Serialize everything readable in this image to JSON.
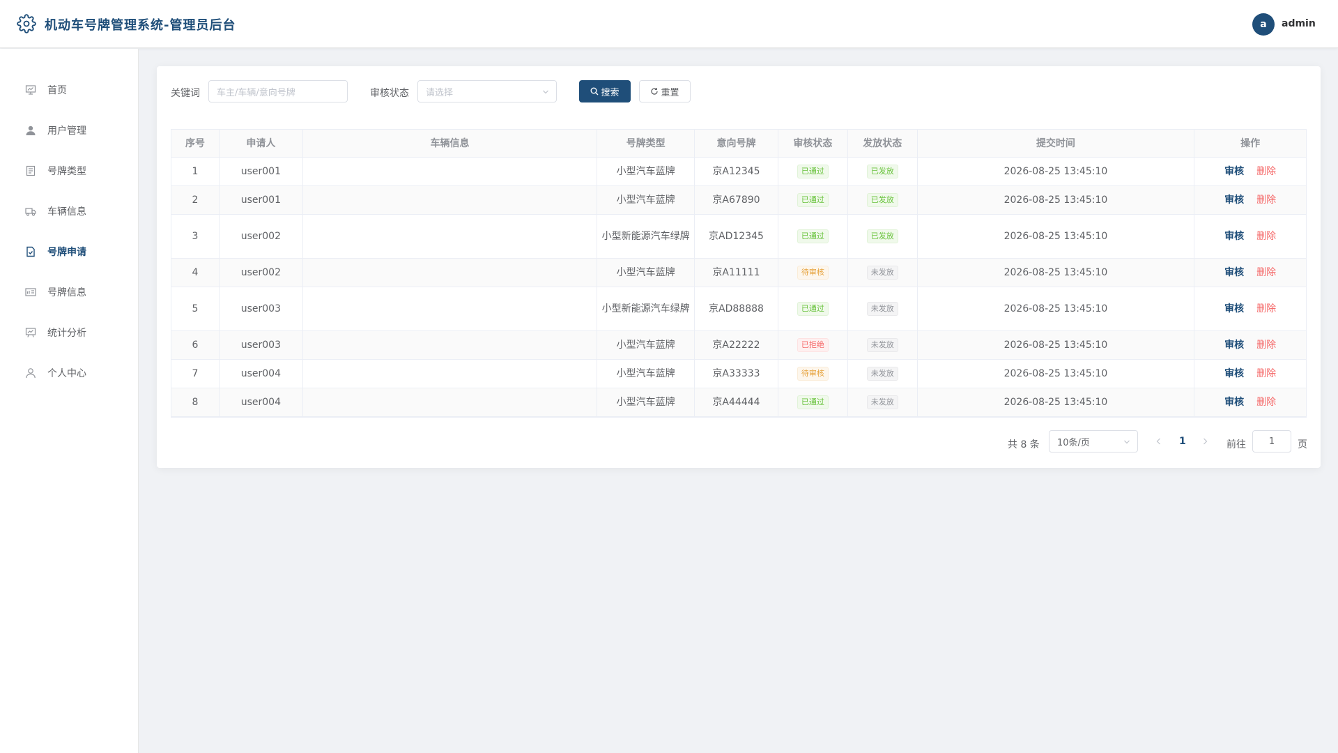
{
  "header": {
    "title": "机动车号牌管理系统-管理员后台",
    "avatar_letter": "a",
    "username": "admin"
  },
  "sidebar": {
    "items": [
      {
        "label": "首页",
        "icon": "chart-board-icon",
        "active": false
      },
      {
        "label": "用户管理",
        "icon": "user-icon",
        "active": false
      },
      {
        "label": "号牌类型",
        "icon": "document-icon",
        "active": false
      },
      {
        "label": "车辆信息",
        "icon": "truck-icon",
        "active": false
      },
      {
        "label": "号牌申请",
        "icon": "document-checked-icon",
        "active": true
      },
      {
        "label": "号牌信息",
        "icon": "postcard-icon",
        "active": false
      },
      {
        "label": "统计分析",
        "icon": "data-board-icon",
        "active": false
      },
      {
        "label": "个人中心",
        "icon": "user-outline-icon",
        "active": false
      }
    ]
  },
  "search": {
    "keyword_label": "关键词",
    "keyword_placeholder": "车主/车辆/意向号牌",
    "status_label": "审核状态",
    "status_placeholder": "请选择",
    "search_button": "搜索",
    "reset_button": "重置"
  },
  "table": {
    "columns": [
      "序号",
      "申请人",
      "车辆信息",
      "号牌类型",
      "意向号牌",
      "审核状态",
      "发放状态",
      "提交时间",
      "操作"
    ],
    "action_audit": "审核",
    "action_delete": "删除",
    "rows": [
      {
        "no": "1",
        "applicant": "user001",
        "vehicle": "",
        "type": "小型汽车蓝牌",
        "plate": "京A12345",
        "audit": "已通过",
        "audit_kind": "success",
        "issue": "已发放",
        "issue_kind": "success",
        "time": "2026-08-25 13:45:10"
      },
      {
        "no": "2",
        "applicant": "user001",
        "vehicle": "",
        "type": "小型汽车蓝牌",
        "plate": "京A67890",
        "audit": "已通过",
        "audit_kind": "success",
        "issue": "已发放",
        "issue_kind": "success",
        "time": "2026-08-25 13:45:10"
      },
      {
        "no": "3",
        "applicant": "user002",
        "vehicle": "",
        "type": "小型新能源汽车绿牌",
        "plate": "京AD12345",
        "audit": "已通过",
        "audit_kind": "success",
        "issue": "已发放",
        "issue_kind": "success",
        "time": "2026-08-25 13:45:10"
      },
      {
        "no": "4",
        "applicant": "user002",
        "vehicle": "",
        "type": "小型汽车蓝牌",
        "plate": "京A11111",
        "audit": "待审核",
        "audit_kind": "warning",
        "issue": "未发放",
        "issue_kind": "info",
        "time": "2026-08-25 13:45:10"
      },
      {
        "no": "5",
        "applicant": "user003",
        "vehicle": "",
        "type": "小型新能源汽车绿牌",
        "plate": "京AD88888",
        "audit": "已通过",
        "audit_kind": "success",
        "issue": "未发放",
        "issue_kind": "info",
        "time": "2026-08-25 13:45:10"
      },
      {
        "no": "6",
        "applicant": "user003",
        "vehicle": "",
        "type": "小型汽车蓝牌",
        "plate": "京A22222",
        "audit": "已拒绝",
        "audit_kind": "danger",
        "issue": "未发放",
        "issue_kind": "info",
        "time": "2026-08-25 13:45:10"
      },
      {
        "no": "7",
        "applicant": "user004",
        "vehicle": "",
        "type": "小型汽车蓝牌",
        "plate": "京A33333",
        "audit": "待审核",
        "audit_kind": "warning",
        "issue": "未发放",
        "issue_kind": "info",
        "time": "2026-08-25 13:45:10"
      },
      {
        "no": "8",
        "applicant": "user004",
        "vehicle": "",
        "type": "小型汽车蓝牌",
        "plate": "京A44444",
        "audit": "已通过",
        "audit_kind": "success",
        "issue": "未发放",
        "issue_kind": "info",
        "time": "2026-08-25 13:45:10"
      }
    ]
  },
  "pagination": {
    "total": "共 8 条",
    "page_size": "10条/页",
    "current_page": "1",
    "goto_label": "前往",
    "goto_value": "1",
    "page_suffix": "页"
  },
  "colors": {
    "brand": "#1f4e79",
    "success": "#67c23a",
    "warning": "#e6a23c",
    "danger": "#f56c6c",
    "info": "#909399"
  }
}
